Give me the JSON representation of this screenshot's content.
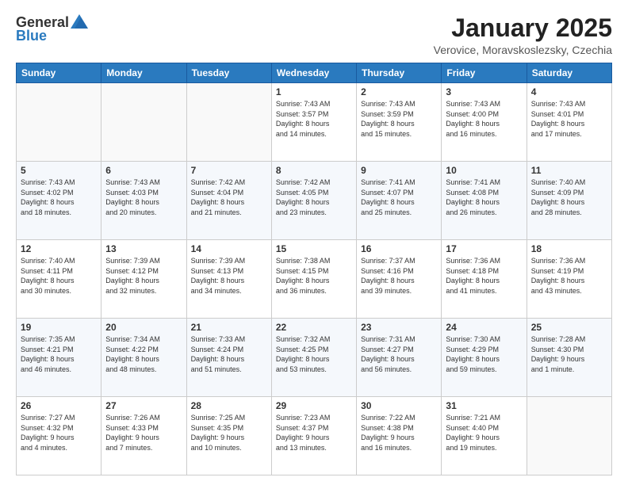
{
  "header": {
    "logo_general": "General",
    "logo_blue": "Blue",
    "month_year": "January 2025",
    "location": "Verovice, Moravskoslezsky, Czechia"
  },
  "days_of_week": [
    "Sunday",
    "Monday",
    "Tuesday",
    "Wednesday",
    "Thursday",
    "Friday",
    "Saturday"
  ],
  "weeks": [
    [
      {
        "day": "",
        "info": ""
      },
      {
        "day": "",
        "info": ""
      },
      {
        "day": "",
        "info": ""
      },
      {
        "day": "1",
        "info": "Sunrise: 7:43 AM\nSunset: 3:57 PM\nDaylight: 8 hours\nand 14 minutes."
      },
      {
        "day": "2",
        "info": "Sunrise: 7:43 AM\nSunset: 3:59 PM\nDaylight: 8 hours\nand 15 minutes."
      },
      {
        "day": "3",
        "info": "Sunrise: 7:43 AM\nSunset: 4:00 PM\nDaylight: 8 hours\nand 16 minutes."
      },
      {
        "day": "4",
        "info": "Sunrise: 7:43 AM\nSunset: 4:01 PM\nDaylight: 8 hours\nand 17 minutes."
      }
    ],
    [
      {
        "day": "5",
        "info": "Sunrise: 7:43 AM\nSunset: 4:02 PM\nDaylight: 8 hours\nand 18 minutes."
      },
      {
        "day": "6",
        "info": "Sunrise: 7:43 AM\nSunset: 4:03 PM\nDaylight: 8 hours\nand 20 minutes."
      },
      {
        "day": "7",
        "info": "Sunrise: 7:42 AM\nSunset: 4:04 PM\nDaylight: 8 hours\nand 21 minutes."
      },
      {
        "day": "8",
        "info": "Sunrise: 7:42 AM\nSunset: 4:05 PM\nDaylight: 8 hours\nand 23 minutes."
      },
      {
        "day": "9",
        "info": "Sunrise: 7:41 AM\nSunset: 4:07 PM\nDaylight: 8 hours\nand 25 minutes."
      },
      {
        "day": "10",
        "info": "Sunrise: 7:41 AM\nSunset: 4:08 PM\nDaylight: 8 hours\nand 26 minutes."
      },
      {
        "day": "11",
        "info": "Sunrise: 7:40 AM\nSunset: 4:09 PM\nDaylight: 8 hours\nand 28 minutes."
      }
    ],
    [
      {
        "day": "12",
        "info": "Sunrise: 7:40 AM\nSunset: 4:11 PM\nDaylight: 8 hours\nand 30 minutes."
      },
      {
        "day": "13",
        "info": "Sunrise: 7:39 AM\nSunset: 4:12 PM\nDaylight: 8 hours\nand 32 minutes."
      },
      {
        "day": "14",
        "info": "Sunrise: 7:39 AM\nSunset: 4:13 PM\nDaylight: 8 hours\nand 34 minutes."
      },
      {
        "day": "15",
        "info": "Sunrise: 7:38 AM\nSunset: 4:15 PM\nDaylight: 8 hours\nand 36 minutes."
      },
      {
        "day": "16",
        "info": "Sunrise: 7:37 AM\nSunset: 4:16 PM\nDaylight: 8 hours\nand 39 minutes."
      },
      {
        "day": "17",
        "info": "Sunrise: 7:36 AM\nSunset: 4:18 PM\nDaylight: 8 hours\nand 41 minutes."
      },
      {
        "day": "18",
        "info": "Sunrise: 7:36 AM\nSunset: 4:19 PM\nDaylight: 8 hours\nand 43 minutes."
      }
    ],
    [
      {
        "day": "19",
        "info": "Sunrise: 7:35 AM\nSunset: 4:21 PM\nDaylight: 8 hours\nand 46 minutes."
      },
      {
        "day": "20",
        "info": "Sunrise: 7:34 AM\nSunset: 4:22 PM\nDaylight: 8 hours\nand 48 minutes."
      },
      {
        "day": "21",
        "info": "Sunrise: 7:33 AM\nSunset: 4:24 PM\nDaylight: 8 hours\nand 51 minutes."
      },
      {
        "day": "22",
        "info": "Sunrise: 7:32 AM\nSunset: 4:25 PM\nDaylight: 8 hours\nand 53 minutes."
      },
      {
        "day": "23",
        "info": "Sunrise: 7:31 AM\nSunset: 4:27 PM\nDaylight: 8 hours\nand 56 minutes."
      },
      {
        "day": "24",
        "info": "Sunrise: 7:30 AM\nSunset: 4:29 PM\nDaylight: 8 hours\nand 59 minutes."
      },
      {
        "day": "25",
        "info": "Sunrise: 7:28 AM\nSunset: 4:30 PM\nDaylight: 9 hours\nand 1 minute."
      }
    ],
    [
      {
        "day": "26",
        "info": "Sunrise: 7:27 AM\nSunset: 4:32 PM\nDaylight: 9 hours\nand 4 minutes."
      },
      {
        "day": "27",
        "info": "Sunrise: 7:26 AM\nSunset: 4:33 PM\nDaylight: 9 hours\nand 7 minutes."
      },
      {
        "day": "28",
        "info": "Sunrise: 7:25 AM\nSunset: 4:35 PM\nDaylight: 9 hours\nand 10 minutes."
      },
      {
        "day": "29",
        "info": "Sunrise: 7:23 AM\nSunset: 4:37 PM\nDaylight: 9 hours\nand 13 minutes."
      },
      {
        "day": "30",
        "info": "Sunrise: 7:22 AM\nSunset: 4:38 PM\nDaylight: 9 hours\nand 16 minutes."
      },
      {
        "day": "31",
        "info": "Sunrise: 7:21 AM\nSunset: 4:40 PM\nDaylight: 9 hours\nand 19 minutes."
      },
      {
        "day": "",
        "info": ""
      }
    ]
  ]
}
